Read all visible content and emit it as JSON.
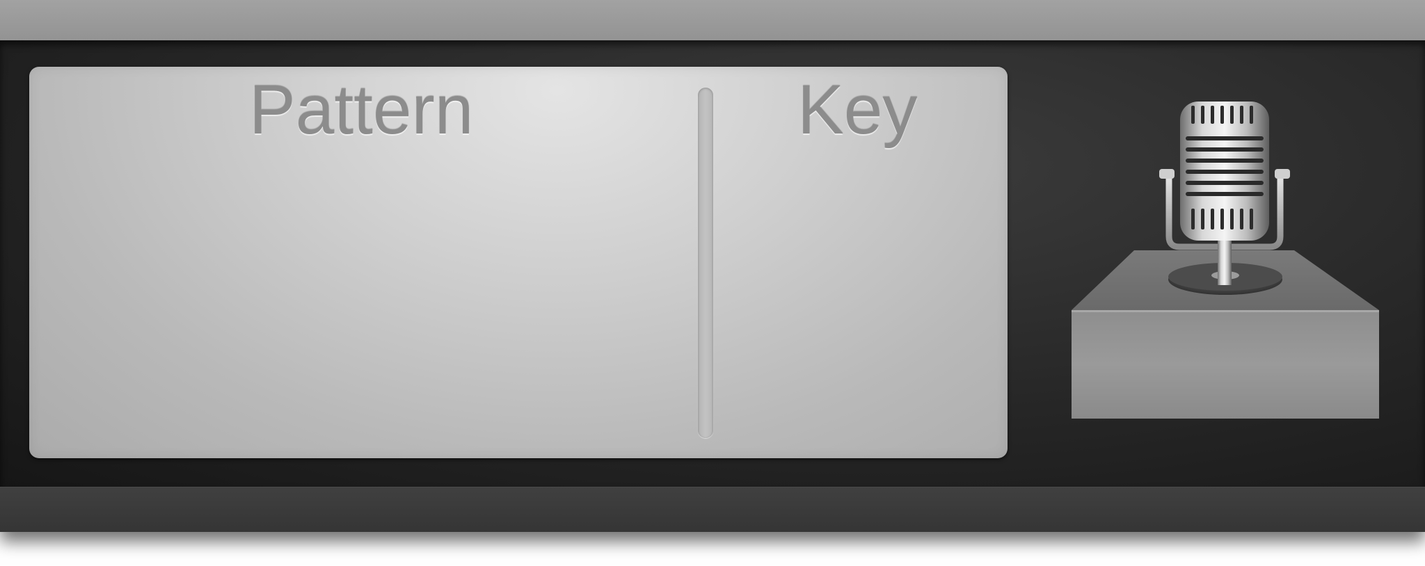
{
  "panel": {
    "columns": [
      {
        "label": "Pattern"
      },
      {
        "label": "Key"
      }
    ]
  },
  "icons": {
    "microphone": "microphone-icon",
    "pedestal": "pedestal-icon"
  },
  "colors": {
    "top_bar": "#999999",
    "body": "#262626",
    "bottom_bar": "#3a3a3a",
    "panel": "#cfcfcf",
    "title_text": "#8c8c8c"
  }
}
